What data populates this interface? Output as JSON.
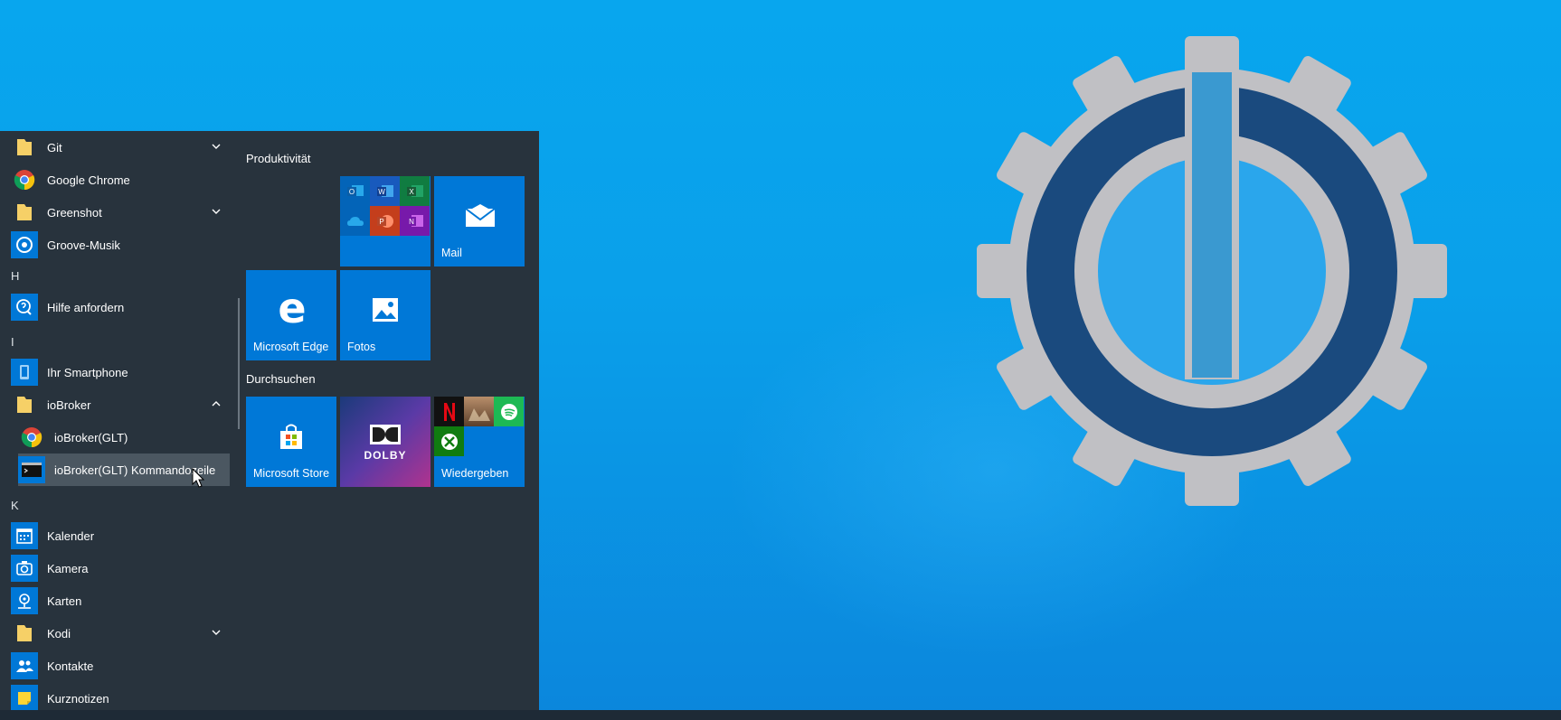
{
  "desktop": {
    "logo": "iobroker-gear-logo"
  },
  "start_menu": {
    "apps": [
      {
        "label": "Git",
        "icon": "folder-icon",
        "expandable": true
      },
      {
        "label": "Google Chrome",
        "icon": "chrome-icon"
      },
      {
        "label": "Greenshot",
        "icon": "folder-icon",
        "expandable": true
      },
      {
        "label": "Groove-Musik",
        "icon": "groove-icon"
      },
      {
        "label": "Hilfe anfordern",
        "icon": "help-icon"
      },
      {
        "label": "Ihr Smartphone",
        "icon": "phone-icon"
      },
      {
        "label": "ioBroker",
        "icon": "folder-icon",
        "expanded": true
      },
      {
        "label": "ioBroker(GLT)",
        "icon": "chrome-icon"
      },
      {
        "label": "ioBroker(GLT) Kommandozeile",
        "icon": "console-icon"
      },
      {
        "label": "Kalender",
        "icon": "calendar-icon"
      },
      {
        "label": "Kamera",
        "icon": "camera-icon"
      },
      {
        "label": "Karten",
        "icon": "maps-icon"
      },
      {
        "label": "Kodi",
        "icon": "folder-icon",
        "expandable": true
      },
      {
        "label": "Kontakte",
        "icon": "contacts-icon"
      },
      {
        "label": "Kurznotizen",
        "icon": "sticky-notes-icon"
      }
    ],
    "letters": [
      "H",
      "I",
      "K"
    ],
    "groups": [
      {
        "title": "Produktivität"
      },
      {
        "title": "Durchsuchen"
      }
    ],
    "tiles": {
      "mail": "Mail",
      "edge": "Microsoft Edge",
      "photos": "Fotos",
      "store": "Microsoft Store",
      "dolby": "DOLBY",
      "play": "Wiedergeben"
    },
    "office_apps": [
      "O",
      "W",
      "X",
      "",
      "P",
      "N"
    ]
  },
  "colors": {
    "tile_blue": "#0078d7",
    "menu_bg": "#28333d",
    "selected_bg": "#4b5761"
  }
}
